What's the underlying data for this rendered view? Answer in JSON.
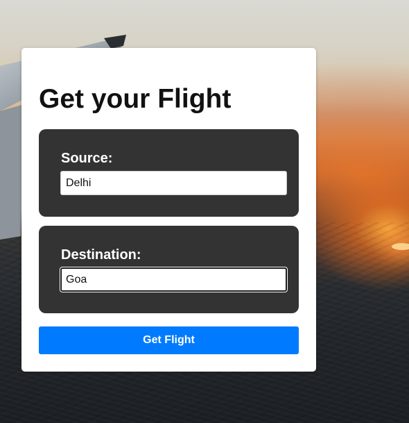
{
  "form": {
    "title": "Get your Flight",
    "source": {
      "label": "Source:",
      "value": "Delhi"
    },
    "destination": {
      "label": "Destination:",
      "value": "Goa"
    },
    "submit_label": "Get Flight"
  },
  "colors": {
    "panel_background": "#333333",
    "button_background": "#007bff",
    "card_background": "#ffffff"
  }
}
